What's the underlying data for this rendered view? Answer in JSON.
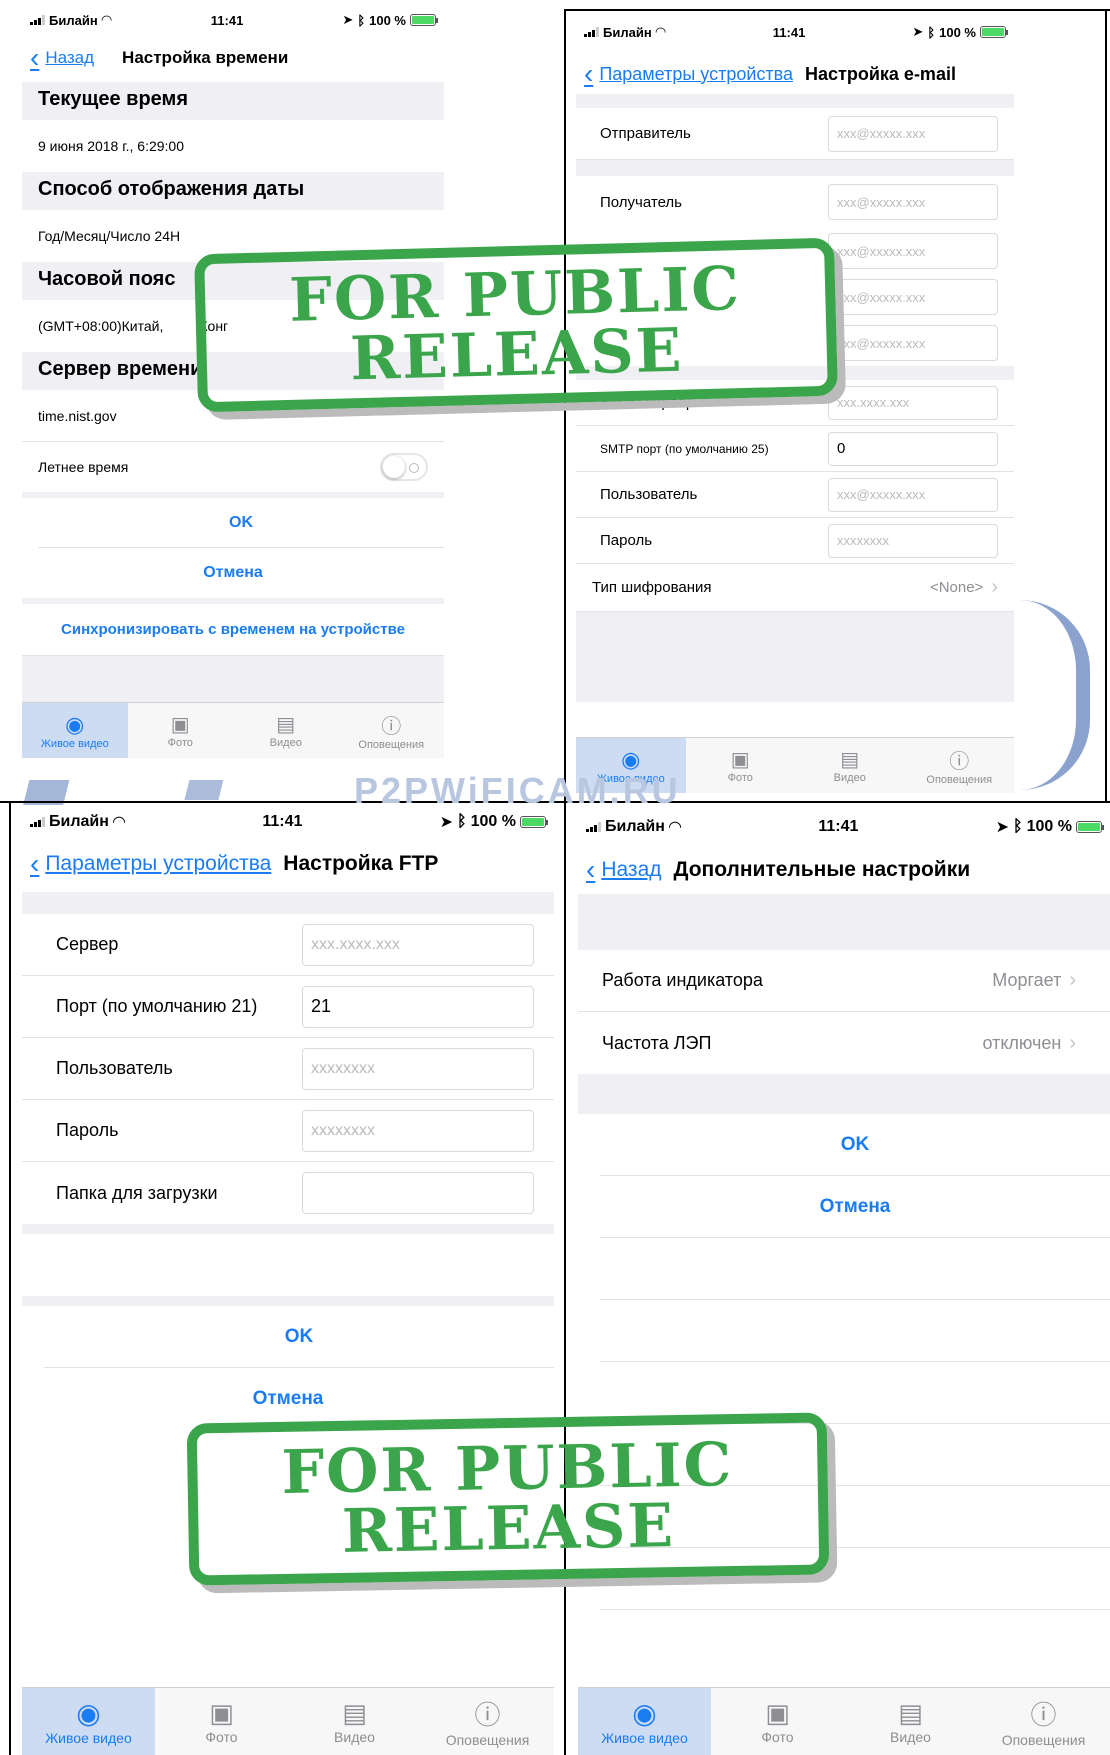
{
  "status_bar": {
    "carrier": "Билайн",
    "time": "11:41",
    "battery": "100 %"
  },
  "watermark": {
    "site": "P2PWiFICAM.RU"
  },
  "stamp": {
    "line1": "FOR PUBLIC",
    "line2": "RELEASE"
  },
  "tabs": [
    {
      "label": "Живое видео",
      "icon": "live-video-icon"
    },
    {
      "label": "Фото",
      "icon": "photo-icon"
    },
    {
      "label": "Видео",
      "icon": "video-camera-icon"
    },
    {
      "label": "Оповещения",
      "icon": "alert-icon"
    }
  ],
  "time_settings": {
    "back": "Назад",
    "title": "Настройка времени",
    "current_time_title": "Текущее время",
    "current_time_value": "9 июня 2018 г., 6:29:00",
    "date_format_title": "Способ отображения даты",
    "date_format_value": "Год/Месяц/Число 24H",
    "timezone_title": "Часовой пояс",
    "timezone_value": "(GMT+08:00)Китай,",
    "timezone_value_tail": "Конг",
    "server_title": "Сервер времени",
    "server_value": "time.nist.gov",
    "dst_label": "Летнее время",
    "ok": "OK",
    "cancel": "Отмена",
    "sync": "Синхронизировать с временем на устройстве"
  },
  "email_settings": {
    "back": "Параметры устройства",
    "title": "Настройка e-mail",
    "sender_label": "Отправитель",
    "recipient_label": "Получатель",
    "email_placeholder": "xxx@xxxxx.xxx",
    "smtp_server_label": "SMTP сервер",
    "smtp_server_placeholder": "xxx.xxxx.xxx",
    "smtp_port_label": "SMTP порт (по умолчанию 25)",
    "smtp_port_value": "0",
    "user_label": "Пользователь",
    "password_label": "Пароль",
    "password_placeholder": "xxxxxxxx",
    "encryption_label": "Тип шифрования",
    "encryption_value": "<None>"
  },
  "ftp_settings": {
    "back": "Параметры устройства",
    "title": "Настройка FTP",
    "server_label": "Сервер",
    "server_placeholder": "xxx.xxxx.xxx",
    "port_label": "Порт (по умолчанию 21)",
    "port_value": "21",
    "user_label": "Пользователь",
    "user_placeholder": "xxxxxxxx",
    "password_label": "Пароль",
    "password_placeholder": "xxxxxxxx",
    "folder_label": "Папка для загрузки",
    "ok": "OK",
    "cancel": "Отмена"
  },
  "advanced_settings": {
    "back": "Назад",
    "title": "Дополнительные настройки",
    "indicator_label": "Работа индикатора",
    "indicator_value": "Моргает",
    "powerline_label": "Частота ЛЭП",
    "powerline_value": "отключен",
    "ok": "OK",
    "cancel": "Отмена"
  }
}
